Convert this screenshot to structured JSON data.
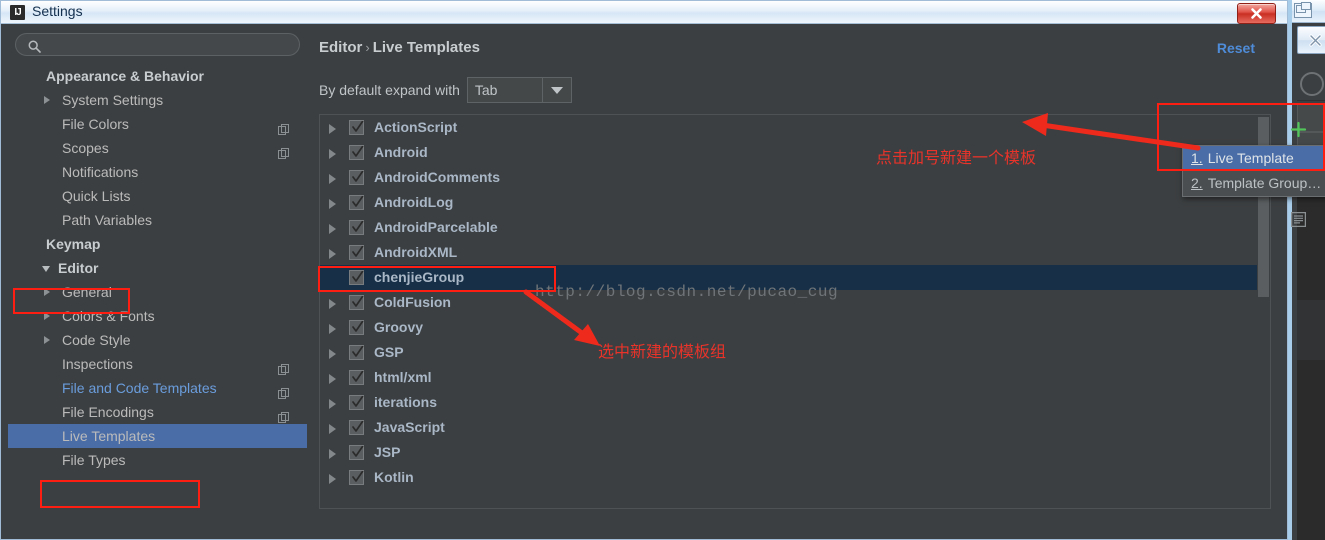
{
  "window": {
    "title": "Settings",
    "icon": "IJ",
    "close_icon": "close-icon"
  },
  "background_window": {
    "restore_icon": "restore-icon",
    "close_icon": "close-icon",
    "search_icon": "search-icon"
  },
  "sidebar": {
    "search": {
      "value": "",
      "placeholder": "",
      "icon": "search-icon"
    },
    "items": [
      {
        "label": "Appearance & Behavior",
        "level": 0,
        "arrow": false,
        "expanded": false,
        "selected": false,
        "copy": false,
        "link": false
      },
      {
        "label": "System Settings",
        "level": 1,
        "arrow": true,
        "expanded": false,
        "selected": false,
        "copy": false,
        "link": false
      },
      {
        "label": "File Colors",
        "level": 1,
        "arrow": false,
        "expanded": false,
        "selected": false,
        "copy": true,
        "link": false
      },
      {
        "label": "Scopes",
        "level": 1,
        "arrow": false,
        "expanded": false,
        "selected": false,
        "copy": true,
        "link": false
      },
      {
        "label": "Notifications",
        "level": 1,
        "arrow": false,
        "expanded": false,
        "selected": false,
        "copy": false,
        "link": false
      },
      {
        "label": "Quick Lists",
        "level": 1,
        "arrow": false,
        "expanded": false,
        "selected": false,
        "copy": false,
        "link": false
      },
      {
        "label": "Path Variables",
        "level": 1,
        "arrow": false,
        "expanded": false,
        "selected": false,
        "copy": false,
        "link": false
      },
      {
        "label": "Keymap",
        "level": 0,
        "arrow": false,
        "expanded": false,
        "selected": false,
        "copy": false,
        "link": false
      },
      {
        "label": "Editor",
        "level": 0,
        "arrow": true,
        "expanded": true,
        "selected": false,
        "copy": false,
        "link": false
      },
      {
        "label": "General",
        "level": 1,
        "arrow": true,
        "expanded": false,
        "selected": false,
        "copy": false,
        "link": false
      },
      {
        "label": "Colors & Fonts",
        "level": 1,
        "arrow": true,
        "expanded": false,
        "selected": false,
        "copy": false,
        "link": false
      },
      {
        "label": "Code Style",
        "level": 1,
        "arrow": true,
        "expanded": false,
        "selected": false,
        "copy": false,
        "link": false
      },
      {
        "label": "Inspections",
        "level": 1,
        "arrow": false,
        "expanded": false,
        "selected": false,
        "copy": true,
        "link": false
      },
      {
        "label": "File and Code Templates",
        "level": 1,
        "arrow": false,
        "expanded": false,
        "selected": false,
        "copy": true,
        "link": true
      },
      {
        "label": "File Encodings",
        "level": 1,
        "arrow": false,
        "expanded": false,
        "selected": false,
        "copy": true,
        "link": false
      },
      {
        "label": "Live Templates",
        "level": 1,
        "arrow": false,
        "expanded": false,
        "selected": true,
        "copy": false,
        "link": false
      },
      {
        "label": "File Types",
        "level": 1,
        "arrow": false,
        "expanded": false,
        "selected": false,
        "copy": false,
        "link": false
      }
    ]
  },
  "content": {
    "breadcrumb": {
      "parent": "Editor",
      "separator": "›",
      "current": "Live Templates"
    },
    "reset_label": "Reset",
    "expand_with": {
      "label": "By default expand with",
      "value": "Tab",
      "dropdown_icon": "chevron-down-icon"
    },
    "templates": [
      {
        "name": "ActionScript",
        "checked": true,
        "arrow": true,
        "selected": false
      },
      {
        "name": "Android",
        "checked": true,
        "arrow": true,
        "selected": false
      },
      {
        "name": "AndroidComments",
        "checked": true,
        "arrow": true,
        "selected": false
      },
      {
        "name": "AndroidLog",
        "checked": true,
        "arrow": true,
        "selected": false
      },
      {
        "name": "AndroidParcelable",
        "checked": true,
        "arrow": true,
        "selected": false
      },
      {
        "name": "AndroidXML",
        "checked": true,
        "arrow": true,
        "selected": false
      },
      {
        "name": "chenjieGroup",
        "checked": true,
        "arrow": false,
        "selected": true
      },
      {
        "name": "ColdFusion",
        "checked": true,
        "arrow": true,
        "selected": false
      },
      {
        "name": "Groovy",
        "checked": true,
        "arrow": true,
        "selected": false
      },
      {
        "name": "GSP",
        "checked": true,
        "arrow": true,
        "selected": false
      },
      {
        "name": "html/xml",
        "checked": true,
        "arrow": true,
        "selected": false
      },
      {
        "name": "iterations",
        "checked": true,
        "arrow": true,
        "selected": false
      },
      {
        "name": "JavaScript",
        "checked": true,
        "arrow": true,
        "selected": false
      },
      {
        "name": "JSP",
        "checked": true,
        "arrow": true,
        "selected": false
      },
      {
        "name": "Kotlin",
        "checked": true,
        "arrow": true,
        "selected": false
      }
    ],
    "watermark": "http://blog.csdn.net/pucao_cug",
    "splitter_grip": "∶∶∶",
    "toolbar": [
      {
        "icon": "plus-icon",
        "name": "add-template-button"
      },
      {
        "icon": "copy-icon",
        "name": "duplicate-template-button"
      },
      {
        "icon": "paste-icon",
        "name": "template-text-button"
      }
    ]
  },
  "popup_menu": {
    "items": [
      {
        "number": "1.",
        "label": "Live Template",
        "highlighted": true
      },
      {
        "number": "2.",
        "label": "Template Group…",
        "highlighted": false
      }
    ]
  },
  "annotations": [
    {
      "text": "点击加号新建一个模板",
      "name": "annotation-click-plus"
    },
    {
      "text": "选中新建的模板组",
      "name": "annotation-select-group"
    }
  ],
  "colors": {
    "accent_blue": "#4a6da7",
    "link_blue": "#4e8cd9",
    "annotation_red": "#e8332a",
    "highlight_box_red": "#ff1f12",
    "plus_green": "#52c45a",
    "panel_bg": "#3c3f41",
    "selected_row_dark": "#173047"
  }
}
